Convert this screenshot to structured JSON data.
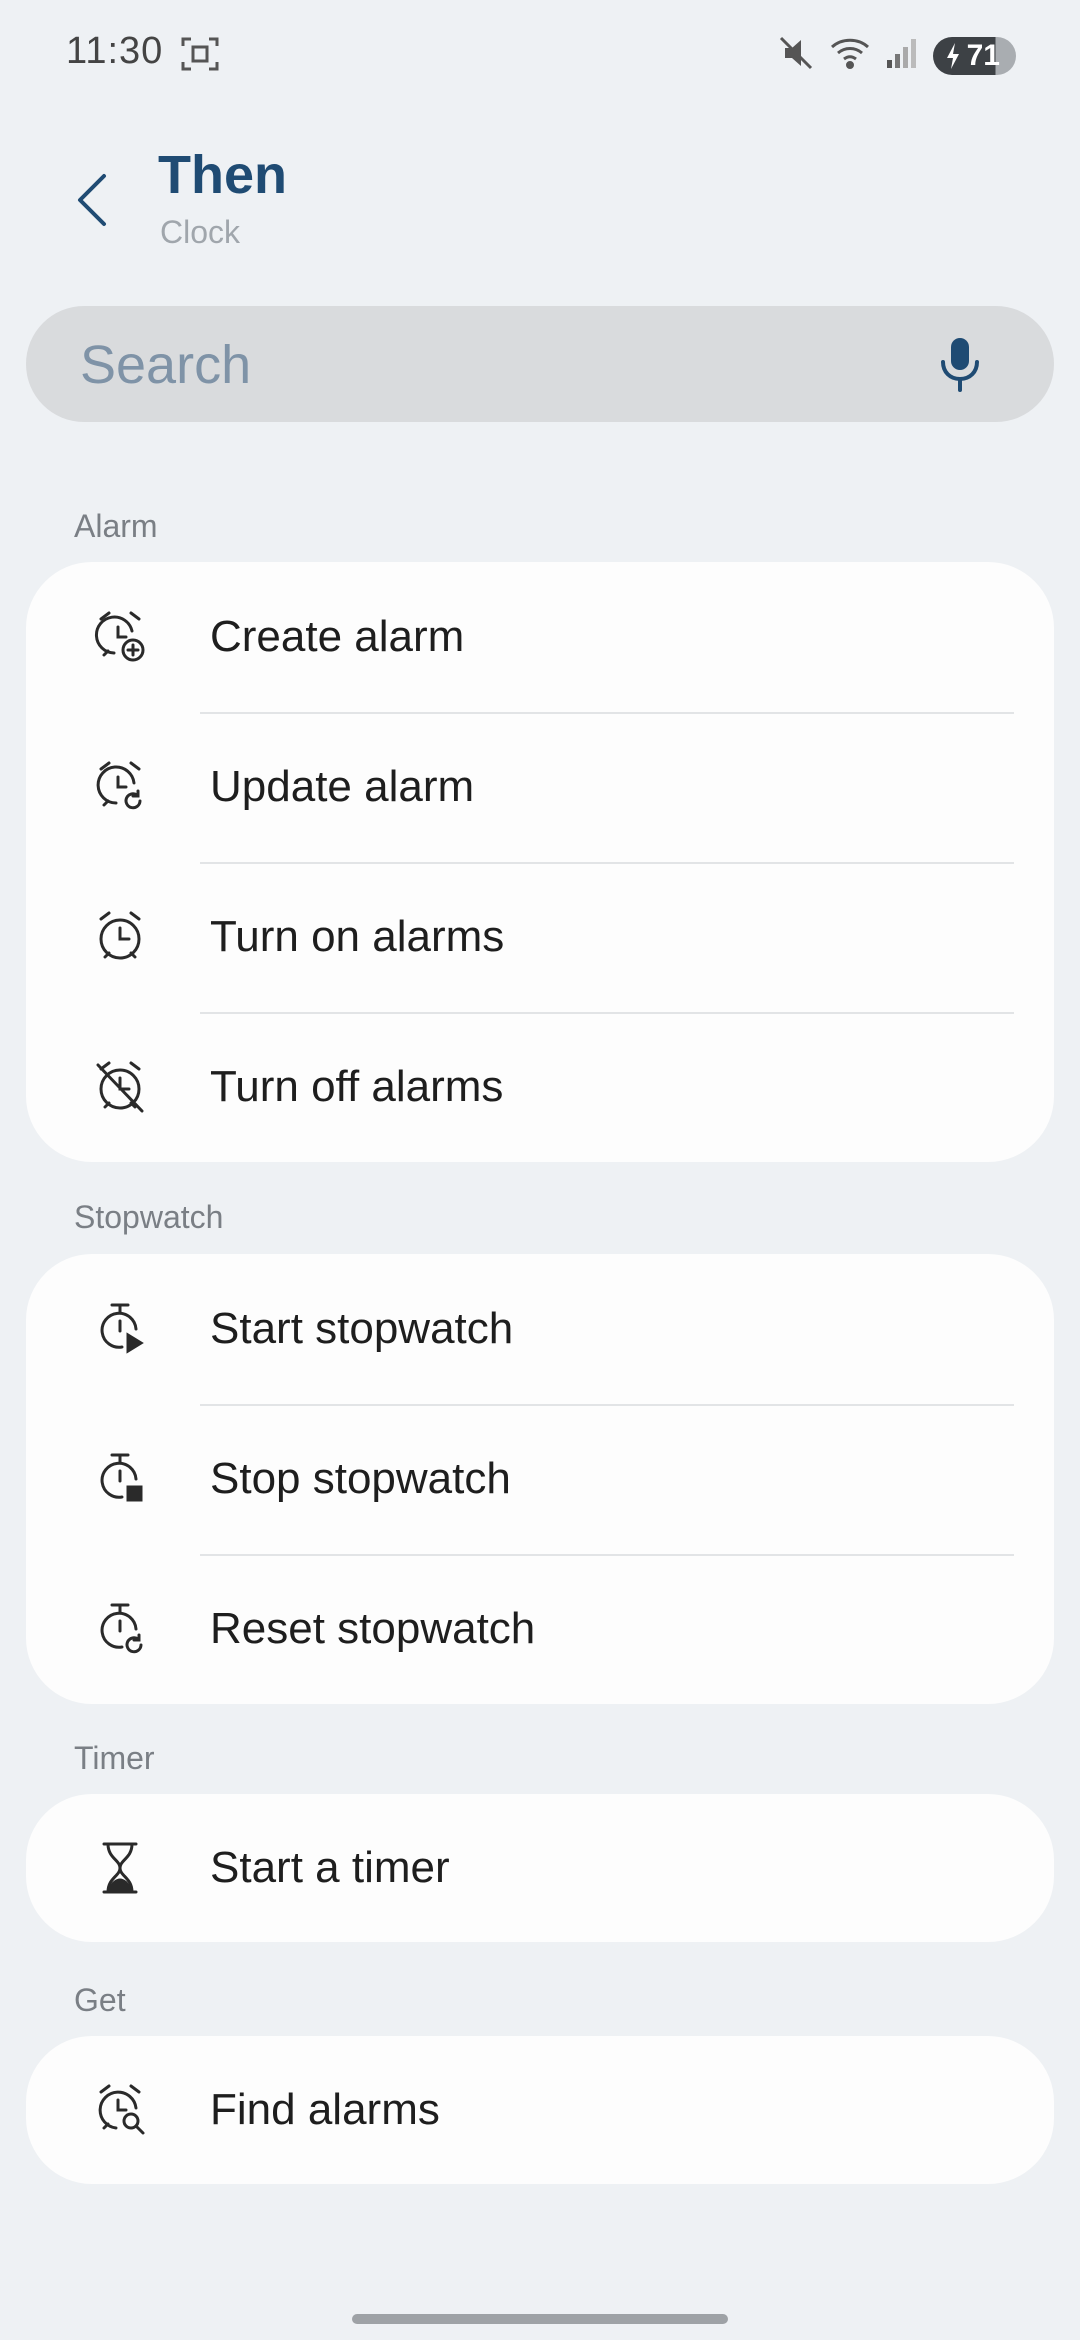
{
  "status_bar": {
    "time": "11:30",
    "battery": "71",
    "icons": [
      "screenshot-icon",
      "mute-icon",
      "wifi-icon",
      "signal-icon",
      "battery-icon"
    ]
  },
  "header": {
    "title": "Then",
    "subtitle": "Clock"
  },
  "search": {
    "placeholder": "Search"
  },
  "sections": [
    {
      "label": "Alarm",
      "items": [
        {
          "label": "Create alarm",
          "icon": "alarm-add-icon"
        },
        {
          "label": "Update alarm",
          "icon": "alarm-update-icon"
        },
        {
          "label": "Turn on alarms",
          "icon": "alarm-icon"
        },
        {
          "label": "Turn off alarms",
          "icon": "alarm-off-icon"
        }
      ]
    },
    {
      "label": "Stopwatch",
      "items": [
        {
          "label": "Start stopwatch",
          "icon": "stopwatch-start-icon"
        },
        {
          "label": "Stop stopwatch",
          "icon": "stopwatch-stop-icon"
        },
        {
          "label": "Reset stopwatch",
          "icon": "stopwatch-reset-icon"
        }
      ]
    },
    {
      "label": "Timer",
      "items": [
        {
          "label": "Start a timer",
          "icon": "hourglass-icon"
        }
      ]
    },
    {
      "label": "Get",
      "items": [
        {
          "label": "Find alarms",
          "icon": "alarm-search-icon"
        }
      ]
    }
  ],
  "colors": {
    "background": "#eef1f4",
    "title": "#1f4b73",
    "card": "#fdfdfd",
    "search_bg": "#d9dbdd"
  }
}
